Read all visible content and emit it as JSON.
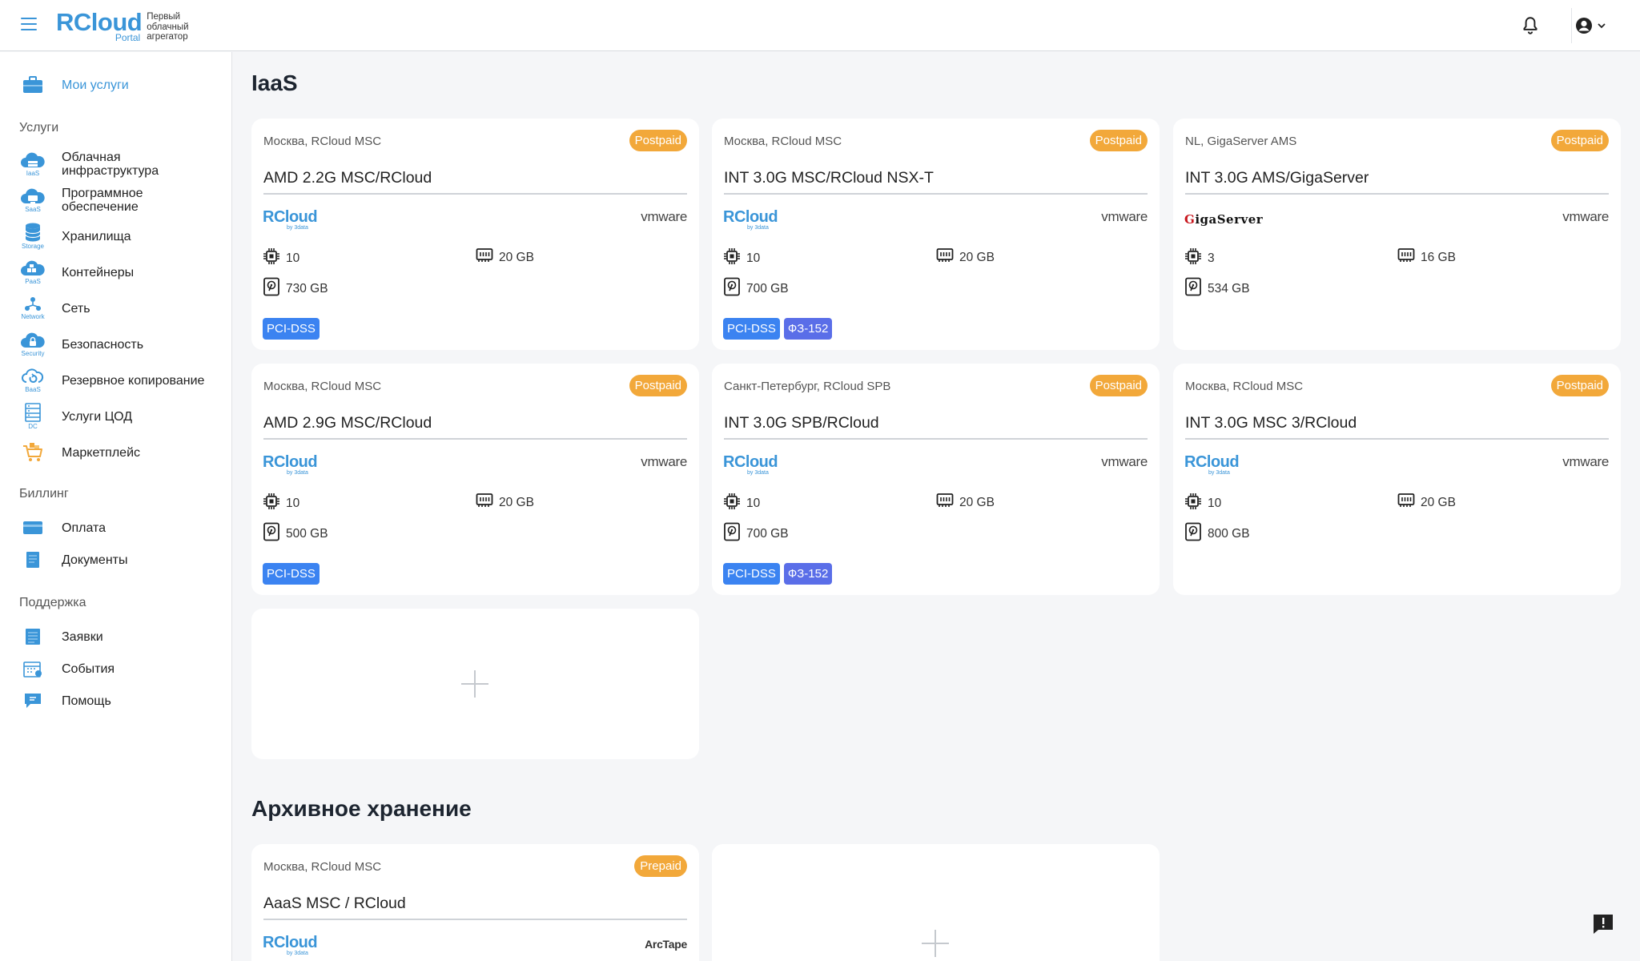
{
  "header": {
    "logo_text": "RCloud",
    "logo_sub": "Portal",
    "logo_tagline": "Первый облачный агрегатор"
  },
  "sidebar": {
    "my_services": "Мои услуги",
    "services_section": "Услуги",
    "services": [
      {
        "label": "Облачная инфраструктура",
        "caption": "IaaS"
      },
      {
        "label": "Программное обеспечение",
        "caption": "SaaS"
      },
      {
        "label": "Хранилища",
        "caption": "Storage"
      },
      {
        "label": "Контейнеры",
        "caption": "PaaS"
      },
      {
        "label": "Сеть",
        "caption": "Network"
      },
      {
        "label": "Безопасность",
        "caption": "Security"
      },
      {
        "label": "Резервное копирование",
        "caption": "BaaS"
      },
      {
        "label": "Услуги ЦОД",
        "caption": "DC"
      },
      {
        "label": "Маркетплейс",
        "caption": ""
      }
    ],
    "billing_section": "Биллинг",
    "billing": [
      "Оплата",
      "Документы"
    ],
    "support_section": "Поддержка",
    "support": [
      "Заявки",
      "События",
      "Помощь"
    ]
  },
  "main": {
    "iaas_title": "IaaS",
    "iaas_cards": [
      {
        "location": "Москва, RCloud MSC",
        "badge": "Postpaid",
        "title": "AMD 2.2G MSC/RCloud",
        "provider": "rcloud",
        "vendor": "vmware",
        "cpu": "10",
        "ram": "20 GB",
        "disk": "730 GB",
        "tags": [
          "PCI-DSS"
        ]
      },
      {
        "location": "Москва, RCloud MSC",
        "badge": "Postpaid",
        "title": "INT 3.0G MSC/RCloud NSX-T",
        "provider": "rcloud",
        "vendor": "vmware",
        "cpu": "10",
        "ram": "20 GB",
        "disk": "700 GB",
        "tags": [
          "PCI-DSS",
          "ФЗ-152"
        ]
      },
      {
        "location": "NL, GigaServer AMS",
        "badge": "Postpaid",
        "title": "INT 3.0G AMS/GigaServer",
        "provider": "giga",
        "vendor": "vmware",
        "cpu": "3",
        "ram": "16 GB",
        "disk": "534 GB",
        "tags": []
      },
      {
        "location": "Москва, RCloud MSC",
        "badge": "Postpaid",
        "title": "AMD 2.9G MSC/RCloud",
        "provider": "rcloud",
        "vendor": "vmware",
        "cpu": "10",
        "ram": "20 GB",
        "disk": "500 GB",
        "tags": [
          "PCI-DSS"
        ]
      },
      {
        "location": "Санкт-Петербург, RCloud SPB",
        "badge": "Postpaid",
        "title": "INT 3.0G SPB/RCloud",
        "provider": "rcloud",
        "vendor": "vmware",
        "cpu": "10",
        "ram": "20 GB",
        "disk": "700 GB",
        "tags": [
          "PCI-DSS",
          "ФЗ-152"
        ]
      },
      {
        "location": "Москва, RCloud MSC",
        "badge": "Postpaid",
        "title": "INT 3.0G MSC 3/RCloud",
        "provider": "rcloud",
        "vendor": "vmware",
        "cpu": "10",
        "ram": "20 GB",
        "disk": "800 GB",
        "tags": []
      }
    ],
    "archive_title": "Архивное хранение",
    "archive_cards": [
      {
        "location": "Москва, RCloud MSC",
        "badge": "Prepaid",
        "title": "AaaS MSC / RCloud",
        "provider": "rcloud",
        "vendor": "ArcTape"
      }
    ],
    "provider_labels": {
      "rcloud": "RCloud",
      "rcloud_sub": "by 3data",
      "giga_g": "G",
      "giga_rest": "igaServer",
      "vmware": "vmware"
    }
  },
  "colors": {
    "accent": "#3a95d8",
    "badge": "#f2a83a",
    "tag_pci": "#3b83f1",
    "tag_fz": "#5a6ee8"
  }
}
